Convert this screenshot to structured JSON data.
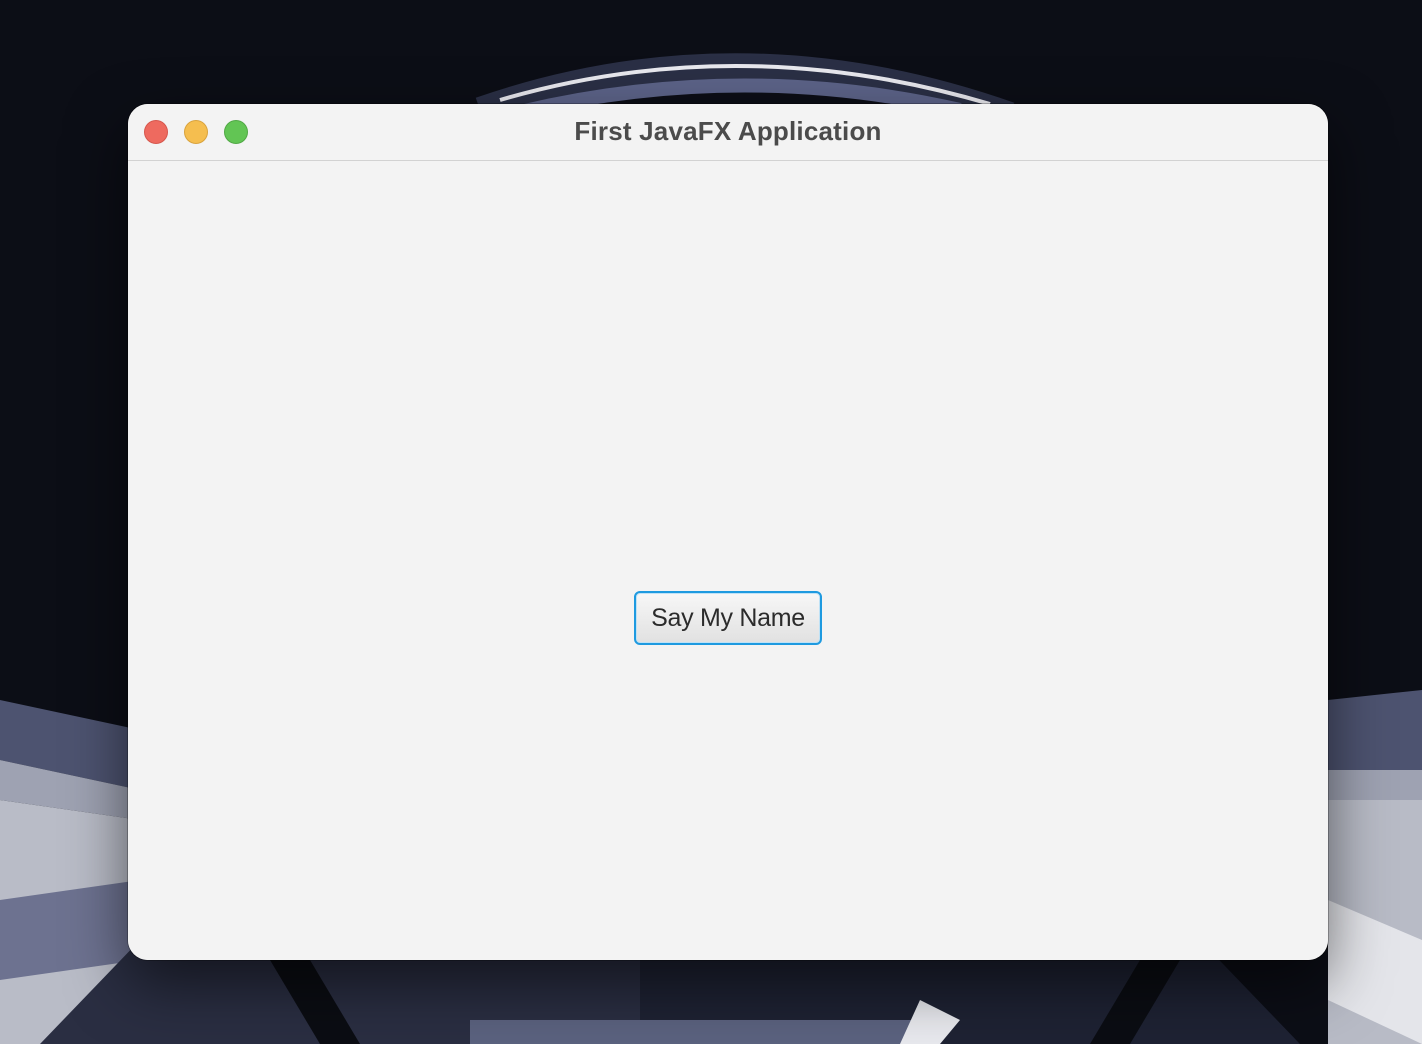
{
  "window": {
    "title": "First JavaFX Application"
  },
  "content": {
    "button_label": "Say My Name"
  },
  "colors": {
    "accent_focus": "#1e9ae0",
    "close": "#ee6a5f",
    "minimize": "#f5be4f",
    "zoom": "#62c554",
    "window_bg": "#f3f3f3"
  }
}
